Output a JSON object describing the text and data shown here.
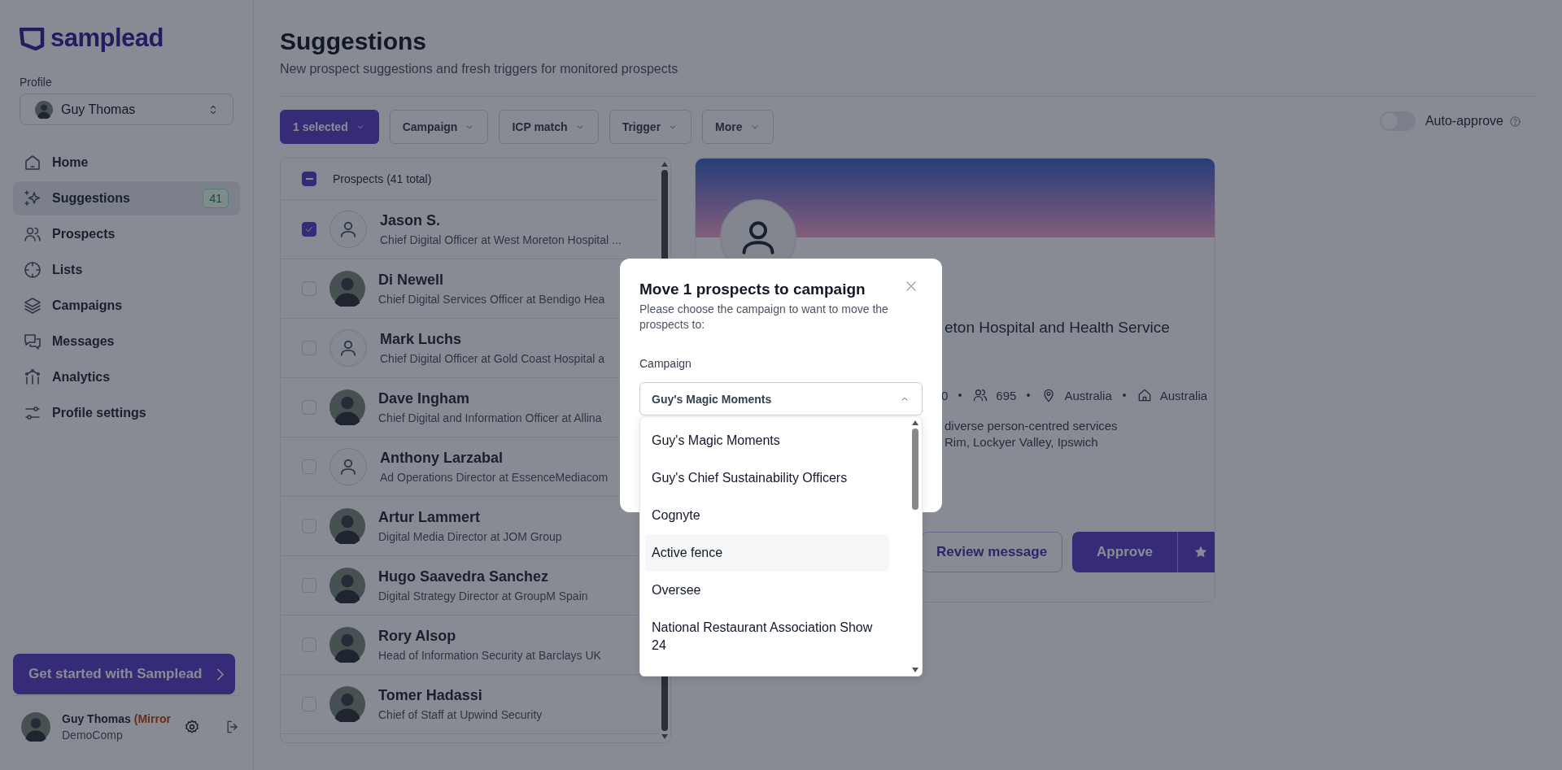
{
  "sidebar": {
    "logo": "samplead",
    "profile_label": "Profile",
    "profile": {
      "name": "Guy Thomas"
    },
    "nav": [
      {
        "label": "Home",
        "selected": false
      },
      {
        "label": "Suggestions",
        "selected": true,
        "badge": "41"
      },
      {
        "label": "Prospects",
        "selected": false
      },
      {
        "label": "Lists",
        "selected": false
      },
      {
        "label": "Campaigns",
        "selected": false
      },
      {
        "label": "Messages",
        "selected": false
      },
      {
        "label": "Analytics",
        "selected": false
      },
      {
        "label": "Profile settings",
        "selected": false
      }
    ],
    "cta": "Get started with Samplead",
    "user": {
      "name": "Guy Thomas",
      "tag": "(Mirror",
      "company": "DemoComp"
    }
  },
  "header": {
    "title": "Suggestions",
    "subtitle": "New prospect suggestions and fresh triggers for monitored prospects"
  },
  "filters": [
    {
      "label": "1 selected",
      "active": true
    },
    {
      "label": "Campaign",
      "active": false
    },
    {
      "label": "ICP match",
      "active": false
    },
    {
      "label": "Trigger",
      "active": false
    },
    {
      "label": "More",
      "active": false
    }
  ],
  "auto_approve": {
    "label": "Auto-approve",
    "on": false
  },
  "prospect_list": {
    "header": "Prospects (41 total)",
    "indeterminate": true,
    "rows": [
      {
        "name": "Jason S.",
        "title": "Chief Digital Officer at West Moreton Hospital ...",
        "kind": "placeholder",
        "checked": true
      },
      {
        "name": "Di Newell",
        "title": "Chief Digital Services Officer at Bendigo Hea",
        "kind": "photo",
        "checked": false
      },
      {
        "name": "Mark Luchs",
        "title": "Chief Digital Officer at Gold Coast Hospital a",
        "kind": "placeholder",
        "checked": false
      },
      {
        "name": "Dave Ingham",
        "title": "Chief Digital and Information Officer at Allina",
        "kind": "photo",
        "checked": false
      },
      {
        "name": "Anthony Larzabal",
        "title": "Ad Operations Director at EssenceMediacom",
        "kind": "placeholder",
        "checked": false
      },
      {
        "name": "Artur Lammert",
        "title": "Digital Media Director at JOM Group",
        "kind": "photo",
        "checked": false
      },
      {
        "name": "Hugo Saavedra Sanchez",
        "title": "Digital Strategy Director at GroupM Spain",
        "kind": "photo",
        "checked": false
      },
      {
        "name": "Rory Alsop",
        "title": "Head of Information Security at Barclays UK",
        "kind": "photo",
        "checked": false
      },
      {
        "name": "Tomer Hadassi",
        "title": "Chief of Staff at Upwind Security",
        "kind": "photo",
        "checked": false
      }
    ]
  },
  "detail": {
    "company_line": "eton Hospital and Health Service",
    "stats": [
      {
        "kind": "text",
        "text": "0"
      },
      {
        "kind": "employees",
        "text": "695"
      },
      {
        "kind": "location",
        "text": "Australia"
      },
      {
        "kind": "hq",
        "text": "Australia"
      }
    ],
    "description": [
      "diverse person-centred services",
      "Rim, Lockyer Valley, Ipswich"
    ],
    "buttons": [
      {
        "label": "Review message",
        "kind": "secondary"
      },
      {
        "label": "Approve",
        "kind": "primary"
      }
    ]
  },
  "modal": {
    "title": "Move 1 prospects to campaign",
    "description": "Please choose the campaign to want to move the prospects to:",
    "field_label": "Campaign",
    "value": "Guy's Magic Moments",
    "expanded": true,
    "options": [
      {
        "label": "Guy's Magic Moments",
        "highlighted": false
      },
      {
        "label": "Guy's Chief Sustainability Officers",
        "highlighted": false
      },
      {
        "label": "Cognyte",
        "highlighted": false
      },
      {
        "label": "Active fence",
        "highlighted": true
      },
      {
        "label": "Oversee",
        "highlighted": false
      },
      {
        "label": "National Restaurant Association Show 24",
        "highlighted": false
      }
    ]
  }
}
